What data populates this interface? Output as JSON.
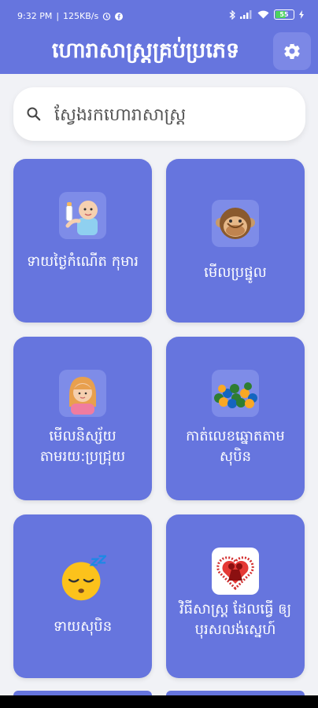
{
  "status_bar": {
    "time": "9:32 PM",
    "speed": "125KB/s",
    "battery": "55"
  },
  "header": {
    "title": "ហោរាសាស្រ្តគ្រប់ប្រភេទ"
  },
  "search": {
    "placeholder": "ស្វែងរកហោរាសាស្រ្ត"
  },
  "cards": [
    {
      "label": "ទាយថ្ងៃកំណើត កុមារ",
      "icon": "baby-icon"
    },
    {
      "label": "មើលប្រផ្នូល",
      "icon": "monkey-icon"
    },
    {
      "label": "មើលនិស្ស័យ តាមរយ:ប្រជ្រុយ",
      "icon": "woman-icon"
    },
    {
      "label": "កាត់លេខឆ្នោតតាម សុបិន",
      "icon": "lottery-balls-icon"
    },
    {
      "label": "ទាយសុបិន",
      "icon": "sleeping-face-icon"
    },
    {
      "label": "វិធីសាស្រ្ត ដែលធ្វើ ឲ្យបុរសលង់ស្នេហ៍",
      "icon": "heart-couple-icon"
    }
  ],
  "colors": {
    "primary": "#6675de",
    "background": "#f1f2f6"
  }
}
